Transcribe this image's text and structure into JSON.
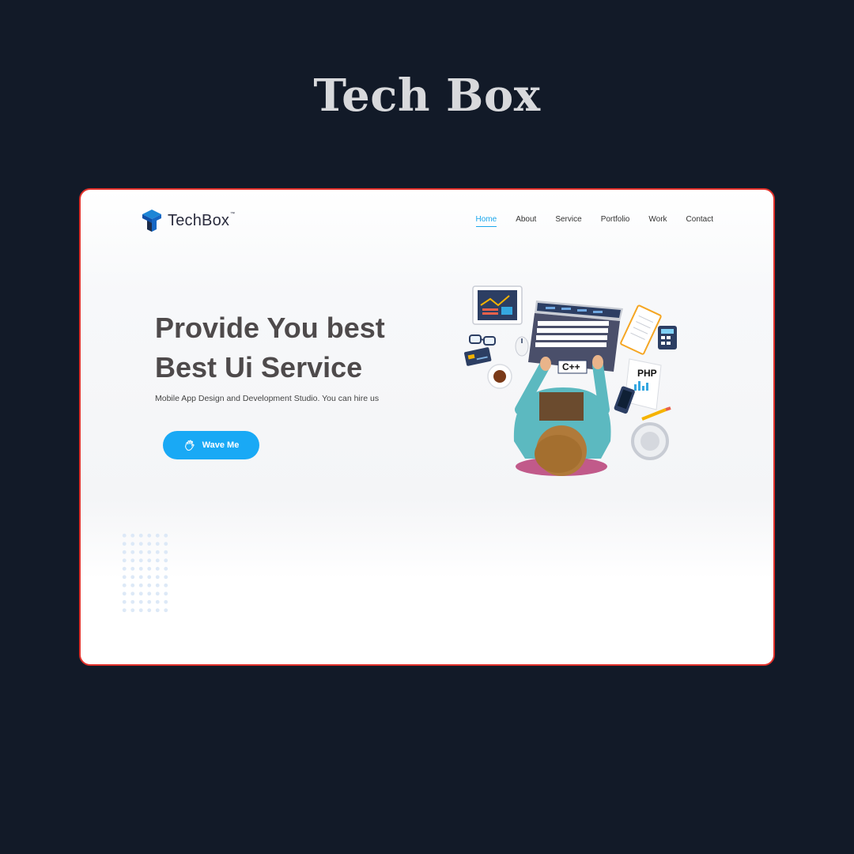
{
  "page_title": "Tech Box",
  "logo": {
    "text": "TechBox",
    "tm": "™"
  },
  "nav": [
    {
      "label": "Home",
      "active": true
    },
    {
      "label": "About"
    },
    {
      "label": "Service"
    },
    {
      "label": "Portfolio"
    },
    {
      "label": "Work"
    },
    {
      "label": "Contact"
    }
  ],
  "hero": {
    "line1": "Provide You best",
    "line2": "Best Ui Service",
    "subtitle": "Mobile App Design and Development Studio. You can hire us",
    "cta_label": "Wave Me",
    "cta_icon": "wave-hand-icon"
  },
  "illustration": {
    "screen_label": "C++",
    "doc_label": "PHP"
  },
  "colors": {
    "background": "#121a28",
    "frame_border": "#e0302a",
    "accent": "#19a9f5",
    "heading": "#4e4a4b"
  }
}
